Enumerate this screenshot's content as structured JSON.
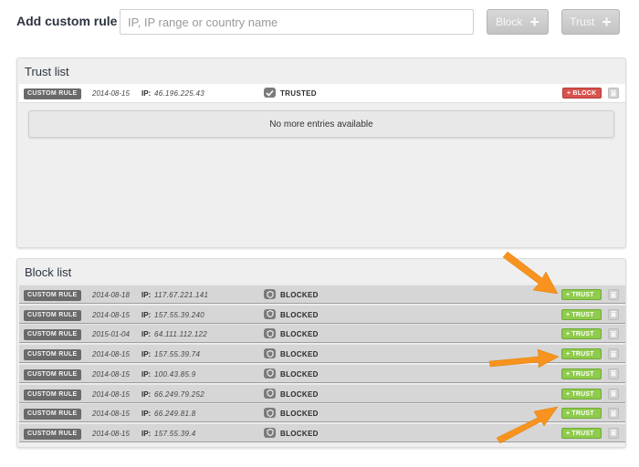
{
  "header": {
    "title": "Add custom rule",
    "input_placeholder": "IP, IP range or country name",
    "block_label": "Block",
    "trust_label": "Trust"
  },
  "trust_list": {
    "title": "Trust list",
    "rows": [
      {
        "badge": "CUSTOM RULE",
        "date": "2014-08-15",
        "ip_label": "IP:",
        "ip": "46.196.225.43",
        "status": "TRUSTED",
        "action": "+ BLOCK"
      }
    ],
    "empty_message": "No more entries available"
  },
  "block_list": {
    "title": "Block list",
    "rows": [
      {
        "badge": "CUSTOM RULE",
        "date": "2014-08-18",
        "ip_label": "IP:",
        "ip": "117.67.221.141",
        "status": "BLOCKED",
        "action": "+ TRUST"
      },
      {
        "badge": "CUSTOM RULE",
        "date": "2014-08-15",
        "ip_label": "IP:",
        "ip": "157.55.39.240",
        "status": "BLOCKED",
        "action": "+ TRUST"
      },
      {
        "badge": "CUSTOM RULE",
        "date": "2015-01-04",
        "ip_label": "IP:",
        "ip": "64.111.112.122",
        "status": "BLOCKED",
        "action": "+ TRUST"
      },
      {
        "badge": "CUSTOM RULE",
        "date": "2014-08-15",
        "ip_label": "IP:",
        "ip": "157.55.39.74",
        "status": "BLOCKED",
        "action": "+ TRUST"
      },
      {
        "badge": "CUSTOM RULE",
        "date": "2014-08-15",
        "ip_label": "IP:",
        "ip": "100.43.85.9",
        "status": "BLOCKED",
        "action": "+ TRUST"
      },
      {
        "badge": "CUSTOM RULE",
        "date": "2014-08-15",
        "ip_label": "IP:",
        "ip": "66.249.79.252",
        "status": "BLOCKED",
        "action": "+ TRUST"
      },
      {
        "badge": "CUSTOM RULE",
        "date": "2014-08-15",
        "ip_label": "IP:",
        "ip": "66.249.81.8",
        "status": "BLOCKED",
        "action": "+ TRUST"
      },
      {
        "badge": "CUSTOM RULE",
        "date": "2014-08-15",
        "ip_label": "IP:",
        "ip": "157.55.39.4",
        "status": "BLOCKED",
        "action": "+ TRUST"
      }
    ]
  },
  "icons": {
    "trusted_status": "check-icon",
    "blocked_status": "shield-icon",
    "delete": "trash-icon",
    "annotation": "arrow-annotation-icon"
  },
  "colors": {
    "block_accent": "#d9534f",
    "trust_accent": "#8fcb4c",
    "annotation_arrow": "#f7931e",
    "badge_bg": "#6a6a6a"
  }
}
